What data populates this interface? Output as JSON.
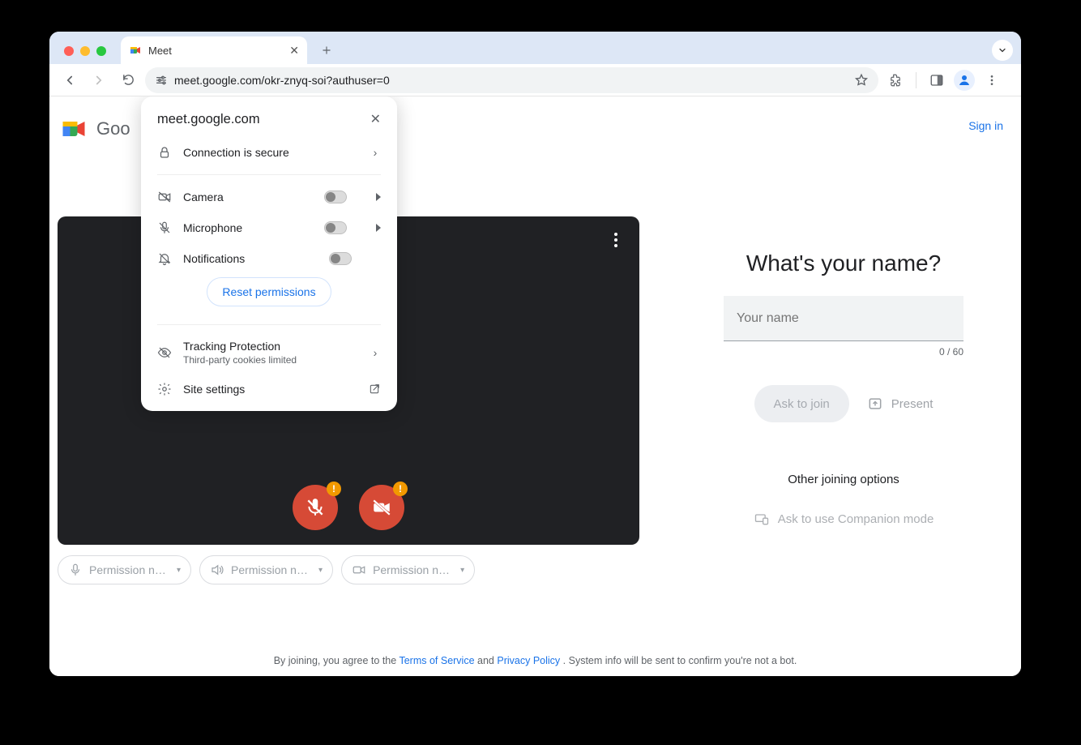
{
  "browser": {
    "tab_title": "Meet",
    "url": "meet.google.com/okr-znyq-soi?authuser=0"
  },
  "popover": {
    "host": "meet.google.com",
    "connection": "Connection is secure",
    "camera": "Camera",
    "microphone": "Microphone",
    "notifications": "Notifications",
    "reset": "Reset permissions",
    "tracking_title": "Tracking Protection",
    "tracking_sub": "Third-party cookies limited",
    "site_settings": "Site settings"
  },
  "meet": {
    "brand": "Goo",
    "signin": "Sign in",
    "perm_chip": "Permission ne…",
    "join_title": "What's your name?",
    "name_placeholder": "Your name",
    "name_count": "0 / 60",
    "ask_join": "Ask to join",
    "present": "Present",
    "other_options": "Other joining options",
    "companion": "Ask to use Companion mode"
  },
  "footer": {
    "pre": "By joining, you agree to the ",
    "tos": "Terms of Service",
    "and": " and ",
    "pp": "Privacy Policy",
    "post": ". System info will be sent to confirm you're not a bot."
  }
}
